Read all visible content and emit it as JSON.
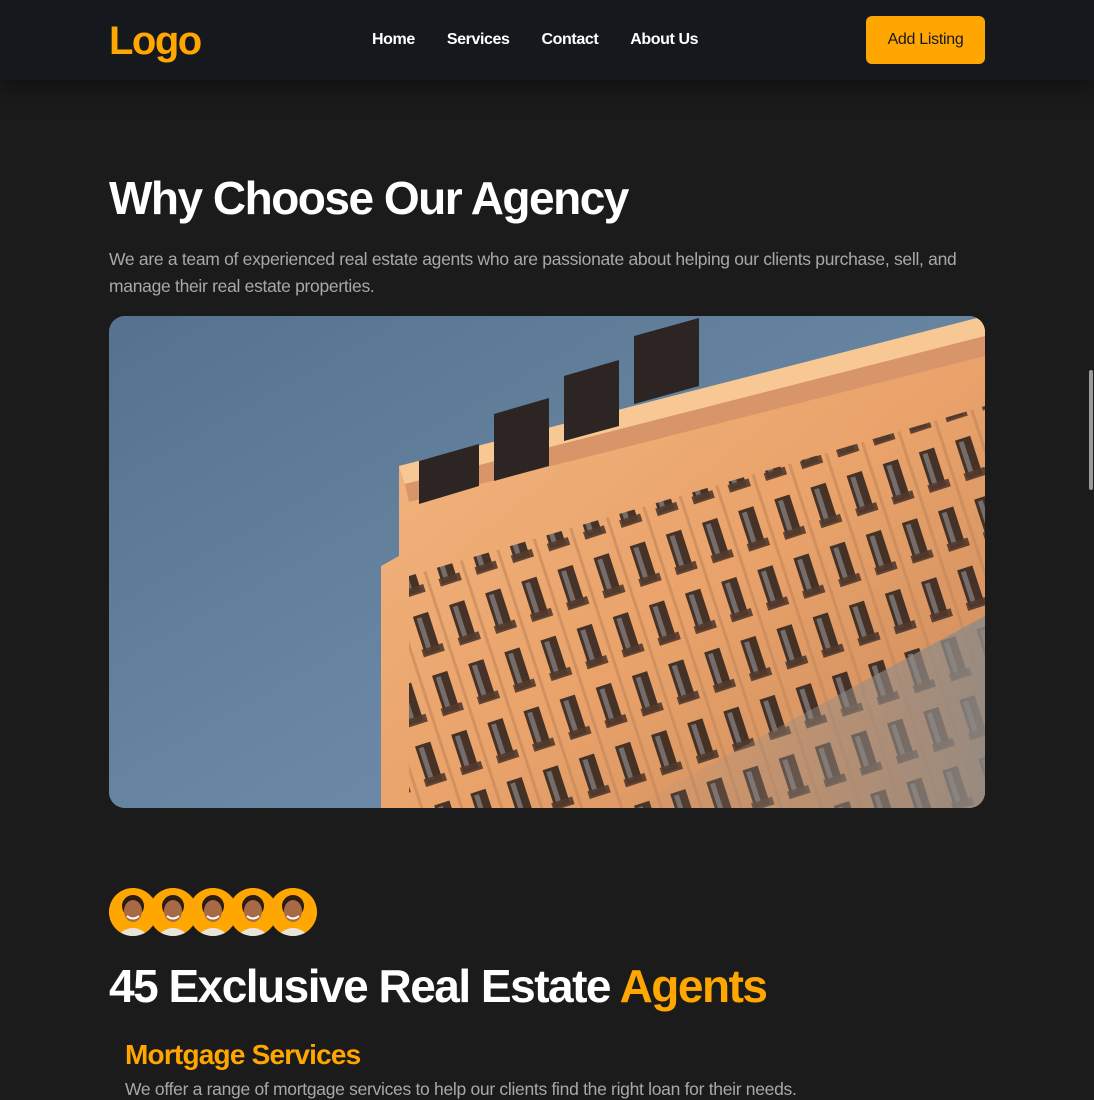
{
  "nav": {
    "logo": "Logo",
    "links": [
      "Home",
      "Services",
      "Contact",
      "About Us"
    ],
    "cta": "Add Listing"
  },
  "why": {
    "title": "Why Choose Our Agency",
    "description": "We are a team of experienced real estate agents who are passionate about helping our clients purchase, sell, and manage their real estate properties."
  },
  "agents": {
    "title_main": "45 Exclusive Real Estate",
    "title_accent": "Agents",
    "avatar_count": 5
  },
  "service": {
    "title": "Mortgage Services",
    "text": "We offer a range of mortgage services to help our clients find the right loan for their needs."
  },
  "colors": {
    "accent": "#ffa600",
    "background": "#1b1b1c",
    "navbar": "#15181c"
  }
}
